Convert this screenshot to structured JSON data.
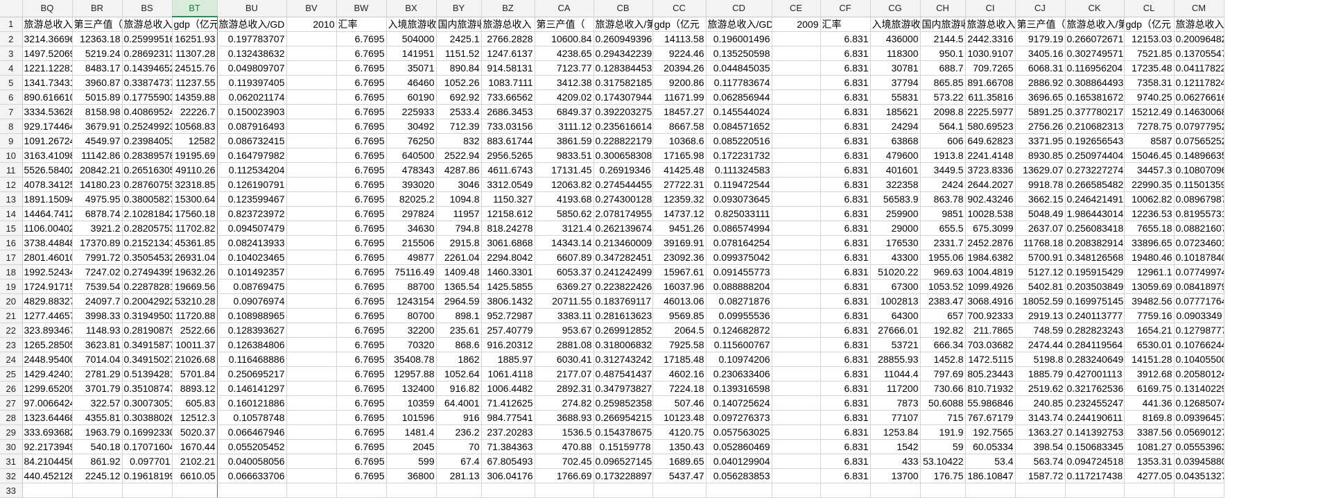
{
  "sheet": {
    "selected_column": "BT",
    "columns": [
      "BQ",
      "BR",
      "BS",
      "BT",
      "BU",
      "BV",
      "BW",
      "BX",
      "BY",
      "BZ",
      "CA",
      "CB",
      "CC",
      "CD",
      "CE",
      "CF",
      "CG",
      "CH",
      "CI",
      "CJ",
      "CK",
      "CL",
      "CM"
    ],
    "rows": [
      [
        "1",
        "旅游总收入（",
        "第三产值（亿",
        "旅游总收入/第",
        "gdp（亿元",
        "旅游总收入/GD",
        "2010",
        "汇率",
        "入境旅游收",
        "国内旅游收",
        "旅游总收入",
        "第三产值（",
        "旅游总收入/第",
        "gdp（亿元",
        "旅游总收入/GD",
        "2009",
        "汇率",
        "入境旅游收",
        "国内旅游收",
        "旅游总收入",
        "第三产值（",
        "旅游总收入/第",
        "gdp（亿元",
        "旅游总收入/GD"
      ],
      [
        "2",
        "3214.36696",
        "12363.18",
        "0.25999516",
        "16251.93",
        "0.197783707",
        "",
        "6.7695",
        "504000",
        "2425.1",
        "2766.2828",
        "10600.84",
        "0.260949396",
        "14113.58",
        "0.196001496",
        "",
        "6.831",
        "436000",
        "2144.5",
        "2442.3316",
        "9179.19",
        "0.266072671",
        "12153.03",
        "0.20096482"
      ],
      [
        "3",
        "1497.520693",
        "5219.24",
        "0.286923133",
        "11307.28",
        "0.132438632",
        "",
        "6.7695",
        "141951",
        "1151.52",
        "1247.6137",
        "4238.65",
        "0.294342239",
        "9224.46",
        "0.135250598",
        "",
        "6.831",
        "118300",
        "950.1",
        "1030.9107",
        "3405.16",
        "0.302749571",
        "7521.85",
        "0.13705547"
      ],
      [
        "4",
        "1221.122818",
        "8483.17",
        "0.143946522",
        "24515.76",
        "0.049809707",
        "",
        "6.7695",
        "35071",
        "890.84",
        "914.58131",
        "7123.77",
        "0.128384453",
        "20394.26",
        "0.044845035",
        "",
        "6.831",
        "30781",
        "688.7",
        "709.7265",
        "6068.31",
        "0.116956204",
        "17235.48",
        "0.04117822"
      ],
      [
        "5",
        "1341.734314",
        "3960.87",
        "0.338747375",
        "11237.55",
        "0.119397405",
        "",
        "6.7695",
        "46460",
        "1052.26",
        "1083.7111",
        "3412.38",
        "0.317582185",
        "9200.86",
        "0.117783674",
        "",
        "6.831",
        "37794",
        "865.85",
        "891.66708",
        "2886.92",
        "0.308864493",
        "7358.31",
        "0.12117824"
      ],
      [
        "6",
        "890.6166104",
        "5015.89",
        "0.177559039",
        "14359.88",
        "0.062021174",
        "",
        "6.7695",
        "60190",
        "692.92",
        "733.66562",
        "4209.02",
        "0.174307944",
        "11671.99",
        "0.062856944",
        "",
        "6.831",
        "55831",
        "573.22",
        "611.35816",
        "3696.65",
        "0.165381672",
        "9740.25",
        "0.06276616"
      ],
      [
        "7",
        "3334.536286",
        "8158.98",
        "0.40869524",
        "22226.7",
        "0.150023903",
        "",
        "6.7695",
        "225933",
        "2533.4",
        "2686.3453",
        "6849.37",
        "0.392203275",
        "18457.27",
        "0.145544024",
        "",
        "6.831",
        "185621",
        "2098.8",
        "2225.5977",
        "5891.25",
        "0.377780217",
        "15212.49",
        "0.14630068"
      ],
      [
        "8",
        "929.1744646",
        "3679.91",
        "0.252499236",
        "10568.83",
        "0.087916493",
        "",
        "6.7695",
        "30492",
        "712.39",
        "733.03156",
        "3111.12",
        "0.235616614",
        "8667.58",
        "0.084571652",
        "",
        "6.831",
        "24294",
        "564.1",
        "580.69523",
        "2756.26",
        "0.210682313",
        "7278.75",
        "0.07977952"
      ],
      [
        "9",
        "1091.267241",
        "4549.97",
        "0.239840535",
        "12582",
        "0.086732415",
        "",
        "6.7695",
        "76250",
        "832",
        "883.61744",
        "3861.59",
        "0.228822179",
        "10368.6",
        "0.085220516",
        "",
        "6.831",
        "63868",
        "606",
        "649.62823",
        "3371.95",
        "0.192656543",
        "8587",
        "0.07565252"
      ],
      [
        "10",
        "3163.41098",
        "11142.86",
        "0.283895784",
        "19195.69",
        "0.164797982",
        "",
        "6.7695",
        "640500",
        "2522.94",
        "2956.5265",
        "9833.51",
        "0.300658308",
        "17165.98",
        "0.172231732",
        "",
        "6.831",
        "479600",
        "1913.8",
        "2241.4148",
        "8930.85",
        "0.250974404",
        "15046.45",
        "0.14896635"
      ],
      [
        "11",
        "5526.584026",
        "20842.21",
        "0.265163053",
        "49110.26",
        "0.112534204",
        "",
        "6.7695",
        "478343",
        "4287.86",
        "4611.6743",
        "17131.45",
        "0.26919346",
        "41425.48",
        "0.111324583",
        "",
        "6.831",
        "401601",
        "3449.5",
        "3723.8336",
        "13629.07",
        "0.273227274",
        "34457.3",
        "0.10807096"
      ],
      [
        "12",
        "4078.341257",
        "14180.23",
        "0.287607553",
        "32318.85",
        "0.126190791",
        "",
        "6.7695",
        "393020",
        "3046",
        "3312.0549",
        "12063.82",
        "0.274544455",
        "27722.31",
        "0.119472544",
        "",
        "6.831",
        "322358",
        "2424",
        "2644.2027",
        "9918.78",
        "0.266585482",
        "22990.35",
        "0.11501359"
      ],
      [
        "13",
        "1891.150949",
        "4975.95",
        "0.38005827",
        "15300.64",
        "0.123599467",
        "",
        "6.7695",
        "82025.2",
        "1094.8",
        "1150.327",
        "4193.68",
        "0.274300128",
        "12359.32",
        "0.093073645",
        "",
        "6.831",
        "56583.9",
        "863.78",
        "902.43246",
        "3662.15",
        "0.246421491",
        "10062.82",
        "0.08967987"
      ],
      [
        "14",
        "14464.74121",
        "6878.74",
        "2.102818425",
        "17560.18",
        "0.823723972",
        "",
        "6.7695",
        "297824",
        "11957",
        "12158.612",
        "5850.62",
        "2.078174955",
        "14737.12",
        "0.825033111",
        "",
        "6.831",
        "259900",
        "9851",
        "10028.538",
        "5048.49",
        "1.986443014",
        "12236.53",
        "0.81955731"
      ],
      [
        "15",
        "1106.00402",
        "3921.2",
        "0.282057539",
        "11702.82",
        "0.094507479",
        "",
        "6.7695",
        "34630",
        "794.8",
        "818.24278",
        "3121.4",
        "0.262139674",
        "9451.26",
        "0.086574994",
        "",
        "6.831",
        "29000",
        "655.5",
        "675.3099",
        "2637.07",
        "0.256083418",
        "7655.18",
        "0.08821607"
      ],
      [
        "16",
        "3738.448487",
        "17370.89",
        "0.215213411",
        "45361.85",
        "0.082413933",
        "",
        "6.7695",
        "215506",
        "2915.8",
        "3061.6868",
        "14343.14",
        "0.213460009",
        "39169.91",
        "0.078164254",
        "",
        "6.831",
        "176530",
        "2331.7",
        "2452.2876",
        "11768.18",
        "0.208382914",
        "33896.65",
        "0.07234601"
      ],
      [
        "17",
        "2801.460104",
        "7991.72",
        "0.350545327",
        "26931.04",
        "0.104023465",
        "",
        "6.7695",
        "49877",
        "2261.04",
        "2294.8042",
        "6607.89",
        "0.347282451",
        "23092.36",
        "0.099375042",
        "",
        "6.831",
        "43300",
        "1955.06",
        "1984.6382",
        "5700.91",
        "0.348126568",
        "19480.46",
        "0.10187840"
      ],
      [
        "18",
        "1992.524346",
        "7247.02",
        "0.274943956",
        "19632.26",
        "0.101492357",
        "",
        "6.7695",
        "75116.49",
        "1409.48",
        "1460.3301",
        "6053.37",
        "0.241242499",
        "15967.61",
        "0.091455773",
        "",
        "6.831",
        "51020.22",
        "969.63",
        "1004.4819",
        "5127.12",
        "0.195915429",
        "12961.1",
        "0.07749974"
      ],
      [
        "19",
        "1724.917152",
        "7539.54",
        "0.228782811",
        "19669.56",
        "0.08769475",
        "",
        "6.7695",
        "88700",
        "1365.54",
        "1425.5855",
        "6369.27",
        "0.223822426",
        "16037.96",
        "0.088888204",
        "",
        "6.831",
        "67300",
        "1053.52",
        "1099.4926",
        "5402.81",
        "0.203503849",
        "13059.69",
        "0.08418979"
      ],
      [
        "20",
        "4829.883271",
        "24097.7",
        "0.200429222",
        "53210.28",
        "0.09076974",
        "",
        "6.7695",
        "1243154",
        "2964.59",
        "3806.1432",
        "20711.55",
        "0.183769117",
        "46013.06",
        "0.08271876",
        "",
        "6.831",
        "1002813",
        "2383.47",
        "3068.4916",
        "18052.59",
        "0.169975145",
        "39482.56",
        "0.07771764"
      ],
      [
        "21",
        "1277.446576",
        "3998.33",
        "0.319495033",
        "11720.88",
        "0.108988965",
        "",
        "6.7695",
        "80700",
        "898.1",
        "952.72987",
        "3383.11",
        "0.281613623",
        "9569.85",
        "0.09955536",
        "",
        "6.831",
        "64300",
        "657",
        "700.92333",
        "2919.13",
        "0.240113777",
        "7759.16",
        "0.0903349"
      ],
      [
        "22",
        "323.8934678",
        "1148.93",
        "0.281908791",
        "2522.66",
        "0.128393627",
        "",
        "6.7695",
        "32200",
        "235.61",
        "257.40779",
        "953.67",
        "0.269912852",
        "2064.5",
        "0.124682872",
        "",
        "6.831",
        "27666.01",
        "192.82",
        "211.7865",
        "748.59",
        "0.282823243",
        "1654.21",
        "0.12798777"
      ],
      [
        "23",
        "1265.285059",
        "3623.81",
        "0.349158775",
        "10011.37",
        "0.126384806",
        "",
        "6.7695",
        "70320",
        "868.6",
        "916.20312",
        "2881.08",
        "0.318006832",
        "7925.58",
        "0.115600767",
        "",
        "6.831",
        "53721",
        "666.34",
        "703.03682",
        "2474.44",
        "0.284119564",
        "6530.01",
        "0.10766244"
      ],
      [
        "24",
        "2448.954001",
        "7014.04",
        "0.349150276",
        "21026.68",
        "0.116468886",
        "",
        "6.7695",
        "35408.78",
        "1862",
        "1885.97",
        "6030.41",
        "0.312743242",
        "17185.48",
        "0.10974206",
        "",
        "6.831",
        "28855.93",
        "1452.8",
        "1472.5115",
        "5198.8",
        "0.283240649",
        "14151.28",
        "0.10405500"
      ],
      [
        "25",
        "1429.424017",
        "2781.29",
        "0.513942817",
        "5701.84",
        "0.250695217",
        "",
        "6.7695",
        "12957.88",
        "1052.64",
        "1061.4118",
        "2177.07",
        "0.487541437",
        "4602.16",
        "0.230633406",
        "",
        "6.831",
        "11044.4",
        "797.69",
        "805.23443",
        "1885.79",
        "0.427001113",
        "3912.68",
        "0.20580124"
      ],
      [
        "26",
        "1299.652092",
        "3701.79",
        "0.351087472",
        "8893.12",
        "0.146141297",
        "",
        "6.7695",
        "132400",
        "916.82",
        "1006.4482",
        "2892.31",
        "0.347973827",
        "7224.18",
        "0.139316598",
        "",
        "6.831",
        "117200",
        "730.66",
        "810.71932",
        "2519.62",
        "0.321762536",
        "6169.75",
        "0.13140229"
      ],
      [
        "27",
        "97.00664244",
        "322.57",
        "0.300730516",
        "605.83",
        "0.160121886",
        "",
        "6.7695",
        "10359",
        "64.4001",
        "71.412625",
        "274.82",
        "0.259852358",
        "507.46",
        "0.140725624",
        "",
        "6.831",
        "7873",
        "50.6088",
        "55.986846",
        "240.85",
        "0.232455247",
        "441.36",
        "0.12685074"
      ],
      [
        "28",
        "1323.644689",
        "4355.81",
        "0.303880263",
        "12512.3",
        "0.10578748",
        "",
        "6.7695",
        "101596",
        "916",
        "984.77541",
        "3688.93",
        "0.266954215",
        "10123.48",
        "0.097276373",
        "",
        "6.831",
        "77107",
        "715",
        "767.67179",
        "3143.74",
        "0.244190611",
        "8169.8",
        "0.09396457"
      ],
      [
        "29",
        "333.6936826",
        "1963.79",
        "0.169923303",
        "5020.37",
        "0.066467946",
        "",
        "6.7695",
        "1481.4",
        "236.2",
        "237.20283",
        "1536.5",
        "0.154378675",
        "4120.75",
        "0.057563025",
        "",
        "6.831",
        "1253.84",
        "191.9",
        "192.7565",
        "1363.27",
        "0.141392753",
        "3387.56",
        "0.05690127"
      ],
      [
        "30",
        "92.21739492",
        "540.18",
        "0.170716048",
        "1670.44",
        "0.055205452",
        "",
        "6.7695",
        "2045",
        "70",
        "71.384363",
        "470.88",
        "0.15159778",
        "1350.43",
        "0.052860469",
        "",
        "6.831",
        "1542",
        "59",
        "60.05334",
        "398.54",
        "0.150683345",
        "1081.27",
        "0.05553963"
      ],
      [
        "31",
        "84.2104456",
        "861.92",
        "0.097701",
        "2102.21",
        "0.040058056",
        "",
        "6.7695",
        "599",
        "67.4",
        "67.805493",
        "702.45",
        "0.096527145",
        "1689.65",
        "0.040129904",
        "",
        "6.831",
        "433",
        "53.10422",
        "53.4",
        "563.74",
        "0.094724518",
        "1353.31",
        "0.03945880"
      ],
      [
        "32",
        "440.452128",
        "2245.12",
        "0.196181998",
        "6610.05",
        "0.066633706",
        "",
        "6.7695",
        "36800",
        "281.13",
        "306.04176",
        "1766.69",
        "0.173228897",
        "5437.47",
        "0.056283853",
        "",
        "6.831",
        "13700",
        "176.75",
        "186.10847",
        "1587.72",
        "0.117217438",
        "4277.05",
        "0.04351327"
      ],
      [
        "33",
        "",
        "",
        "",
        "",
        "",
        "",
        "",
        "",
        "",
        "",
        "",
        "",
        "",
        "",
        "",
        "",
        "",
        "",
        "",
        "",
        "",
        "",
        ""
      ]
    ]
  }
}
